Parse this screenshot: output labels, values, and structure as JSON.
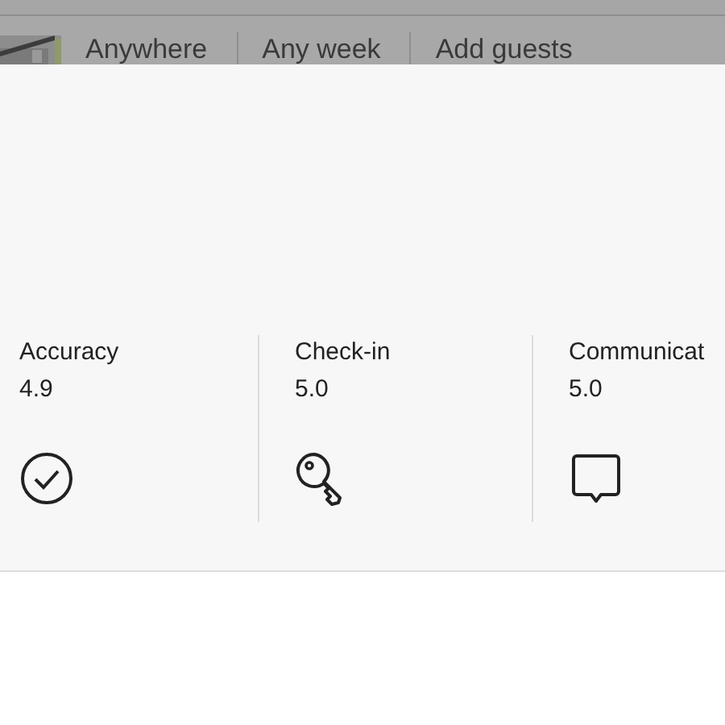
{
  "header": {
    "items": [
      {
        "label": "Anywhere"
      },
      {
        "label": "Any week"
      },
      {
        "label": "Add guests"
      }
    ]
  },
  "ratings": [
    {
      "label": "Accuracy",
      "value": "4.9",
      "kind": "check"
    },
    {
      "label": "Check-in",
      "value": "5.0",
      "kind": "key"
    },
    {
      "label": "Communicat",
      "value": "5.0",
      "kind": "chat"
    }
  ]
}
